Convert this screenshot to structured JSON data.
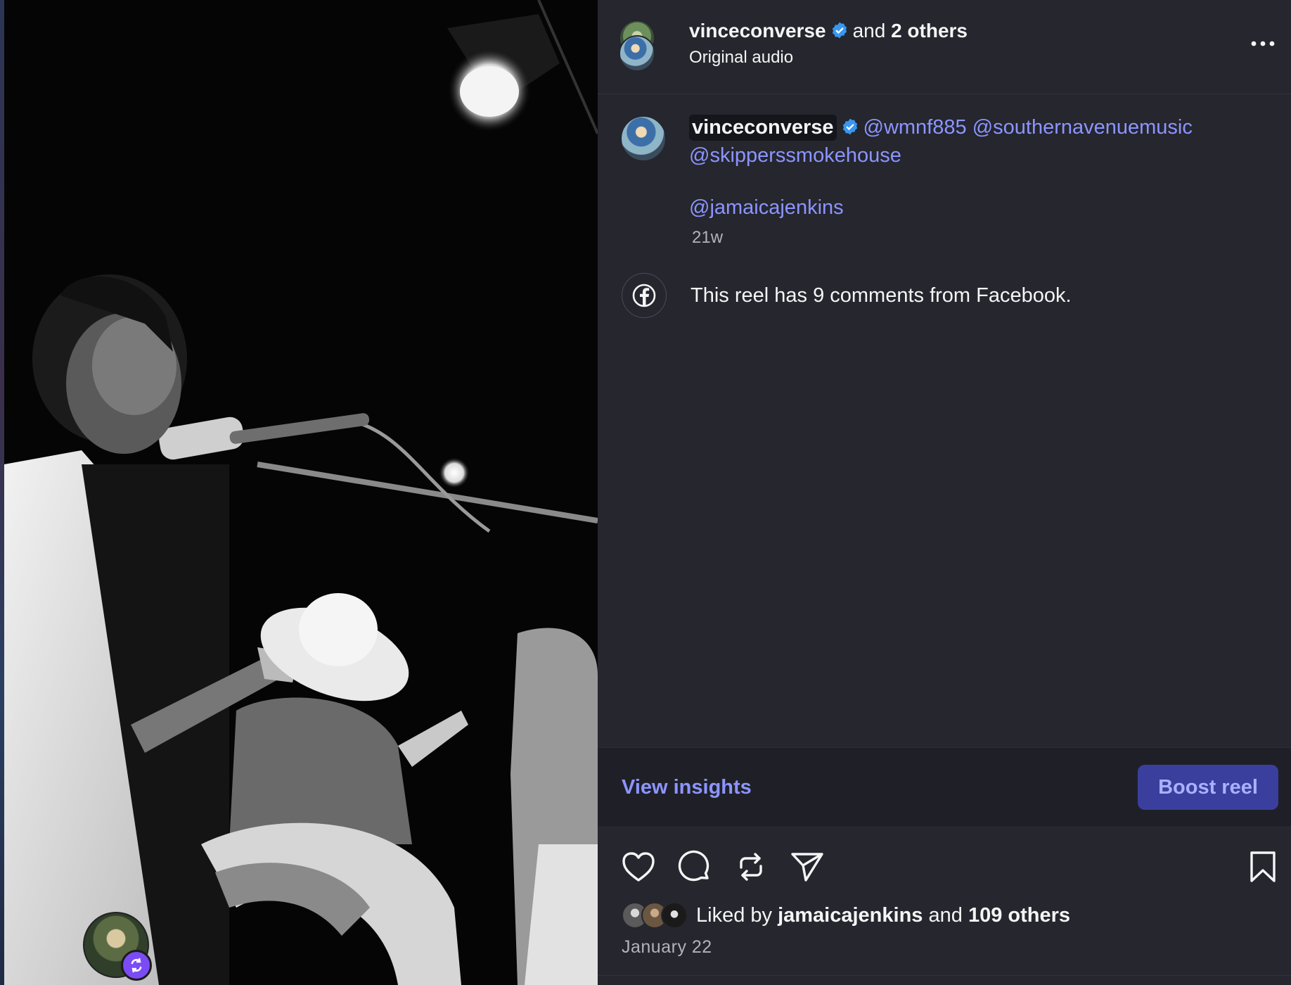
{
  "header": {
    "author": "vinceconverse",
    "connector": "and",
    "others": "2 others",
    "audio": "Original audio"
  },
  "caption": {
    "author": "vinceconverse",
    "mentions": [
      "@wmnf885",
      "@southernavenuemusic",
      "@skipperssmokehouse",
      "@jamaicajenkins"
    ],
    "time": "21w"
  },
  "facebook_notice": "This reel has 9 comments from Facebook.",
  "insights": {
    "view_label": "View insights",
    "boost_label": "Boost reel"
  },
  "likes": {
    "prefix": "Liked by",
    "user": "jamaicajenkins",
    "connector": "and",
    "others": "109 others"
  },
  "date": "January 22",
  "icons": [
    "more-icon",
    "verified-icon",
    "facebook-icon",
    "heart-icon",
    "comment-icon",
    "repost-icon",
    "share-icon",
    "bookmark-icon",
    "remix-icon"
  ],
  "colors": {
    "panel_bg": "#25262e",
    "link": "#8c95ff",
    "verified": "#3897f0",
    "boost_bg": "#3a3f9e",
    "remix_badge": "#7b4cf5"
  }
}
